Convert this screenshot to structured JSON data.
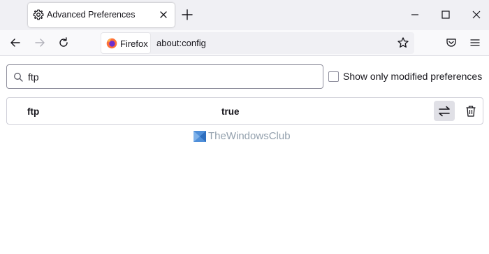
{
  "tab": {
    "title": "Advanced Preferences",
    "icon": "gear-icon"
  },
  "urlbar": {
    "identity_label": "Firefox",
    "url": "about:config"
  },
  "search": {
    "value": "ftp"
  },
  "filter": {
    "label": "Show only modified preferences",
    "checked": false
  },
  "preference": {
    "name": "ftp",
    "value": "true"
  },
  "watermark": {
    "text": "TheWindowsClub"
  },
  "colors": {
    "tabstrip_bg": "#f0f0f4",
    "navbar_bg": "#f9f9fb",
    "toggle_bg": "#e0e0e6",
    "text": "#15141a",
    "watermark": "#93a0ad"
  }
}
